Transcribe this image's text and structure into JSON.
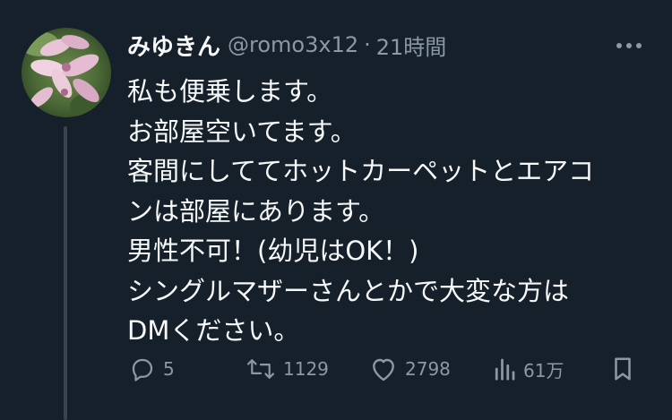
{
  "tweet": {
    "display_name": "みゆきん",
    "handle": "@romo3x12",
    "separator": "·",
    "time": "21時間",
    "text_lines": [
      "私も便乗します。",
      "お部屋空いてます。",
      "客間にしててホットカーペットとエアコ",
      "ンは部屋にあります。",
      "男性不可！(幼児はOK！)",
      "シングルマザーさんとかで大変な方は",
      "DMください。"
    ]
  },
  "actions": {
    "reply_count": "5",
    "retweet_count": "1129",
    "like_count": "2798",
    "views_count": "61万"
  },
  "icons": {
    "more": "more-icon",
    "reply": "reply-icon",
    "retweet": "retweet-icon",
    "like": "heart-icon",
    "views": "views-icon",
    "bookmark": "bookmark-icon"
  },
  "colors": {
    "background": "#15202b",
    "text": "#f7f9f9",
    "secondary": "#8b98a5",
    "thread_line": "#38444d"
  }
}
